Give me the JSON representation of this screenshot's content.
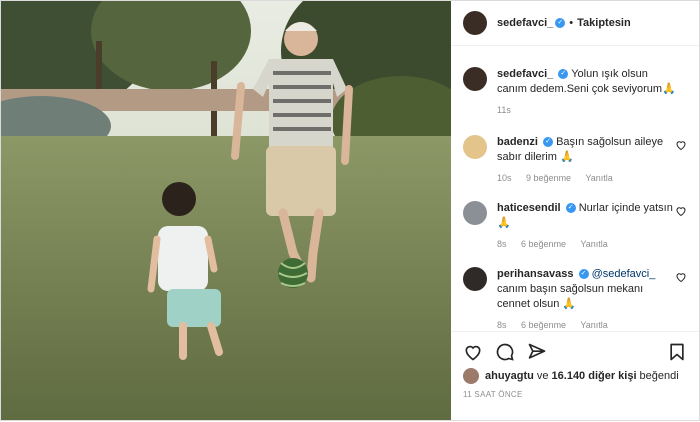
{
  "header": {
    "username": "sedefavci_",
    "follow_label": "Takiptesin"
  },
  "caption": {
    "username": "sedefavci_",
    "text": "Yolun ışık olsun canım dedem.Seni çok seviyorum🙏",
    "time": "11s"
  },
  "comments": [
    {
      "username": "badenzi",
      "text": "Başın sağolsun aileye sabır dilerim 🙏",
      "time": "10s",
      "likes": "9 beğenme",
      "reply": "Yanıtla"
    },
    {
      "username": "haticesendil",
      "text": "Nurlar içinde yatsın🙏",
      "time": "8s",
      "likes": "6 beğenme",
      "reply": "Yanıtla"
    },
    {
      "username": "perihansavass",
      "mention": "@sedefavci_",
      "text": "canım başın sağolsun mekanı cennet olsun 🙏",
      "time": "8s",
      "likes": "6 beğenme",
      "reply": "Yanıtla"
    }
  ],
  "likes": {
    "user": "ahuyagtu",
    "connector": "ve",
    "count_text": "16.140 diğer kişi",
    "suffix": "beğendi"
  },
  "post_time": "11 SAAT ÖNCE",
  "icons": [
    "heart-icon",
    "comment-icon",
    "share-icon",
    "bookmark-icon"
  ]
}
